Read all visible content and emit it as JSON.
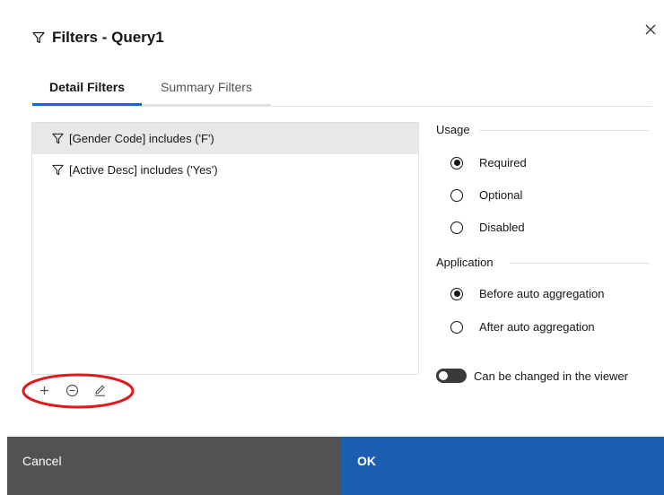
{
  "dialog": {
    "title": "Filters - Query1",
    "title_icon": "filter-icon",
    "close_icon": "close-icon"
  },
  "tabs": [
    {
      "label": "Detail Filters",
      "active": true
    },
    {
      "label": "Summary Filters",
      "active": false
    }
  ],
  "filters": [
    {
      "label": "[Gender Code] includes ('F')",
      "icon": "filter-icon",
      "selected": true
    },
    {
      "label": "[Active Desc] includes ('Yes')",
      "icon": "filter-icon",
      "selected": false
    }
  ],
  "toolbar": {
    "add": "+",
    "items": [
      "add-icon",
      "remove-icon",
      "edit-icon"
    ]
  },
  "usage": {
    "label": "Usage",
    "options": [
      {
        "label": "Required",
        "checked": true
      },
      {
        "label": "Optional",
        "checked": false
      },
      {
        "label": "Disabled",
        "checked": false
      }
    ]
  },
  "application": {
    "label": "Application",
    "options": [
      {
        "label": "Before auto aggregation",
        "checked": true
      },
      {
        "label": "After auto aggregation",
        "checked": false
      }
    ]
  },
  "viewer_toggle": {
    "label": "Can be changed in the viewer",
    "on": true
  },
  "footer": {
    "cancel_label": "Cancel",
    "ok_label": "OK"
  },
  "colors": {
    "cancel_bg": "#525252",
    "ok_bg": "#1c5eb0",
    "tab_accent": "#0f62fe",
    "annotation": "#e0191e"
  }
}
